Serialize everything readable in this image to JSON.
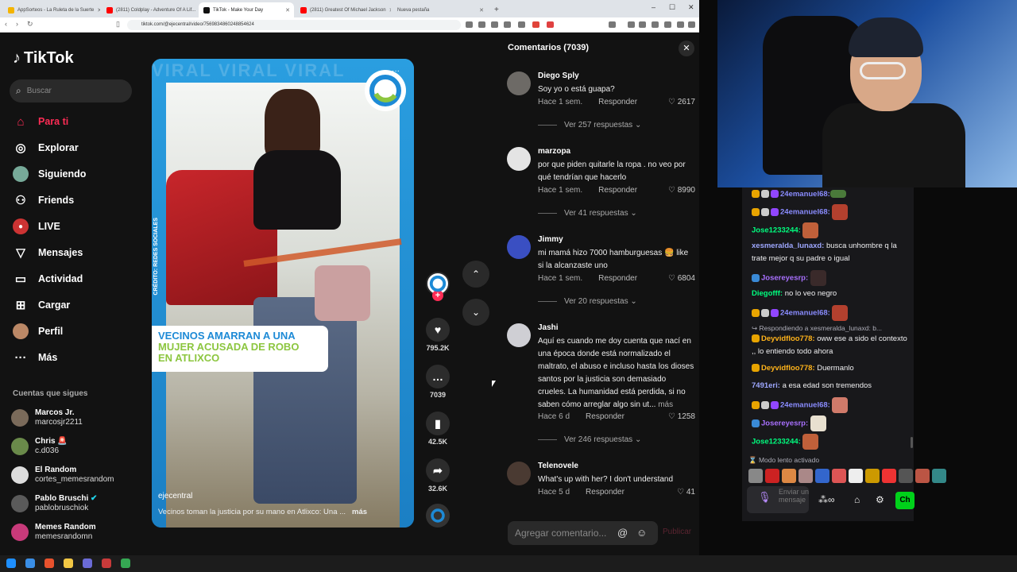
{
  "browser": {
    "tabs": [
      {
        "title": "AppSorteos - La Ruleta de la Suerte",
        "color": "#f4b400"
      },
      {
        "title": "(2811) Coldplay - Adventure Of A Lif...",
        "color": "#ff0000"
      },
      {
        "title": "TikTok - Make Your Day",
        "color": "#111111",
        "active": true
      },
      {
        "title": "(2811) Greatest Of Michael Jackson",
        "color": "#ff0000"
      },
      {
        "title": "Nueva pestaña",
        "color": "#cccccc"
      }
    ],
    "url": "tiktok.com/@ejecentral/video/7569834860248854624"
  },
  "sidebar": {
    "logo": "TikTok",
    "search_placeholder": "Buscar",
    "nav": [
      {
        "label": "Para ti",
        "icon": "home-icon",
        "active": true
      },
      {
        "label": "Explorar",
        "icon": "compass-icon"
      },
      {
        "label": "Siguiendo",
        "icon": "following-icon"
      },
      {
        "label": "Friends",
        "icon": "friends-icon"
      },
      {
        "label": "LIVE",
        "icon": "live-icon"
      },
      {
        "label": "Mensajes",
        "icon": "messages-icon"
      },
      {
        "label": "Actividad",
        "icon": "activity-icon"
      },
      {
        "label": "Cargar",
        "icon": "upload-icon"
      },
      {
        "label": "Perfil",
        "icon": "profile-icon"
      },
      {
        "label": "Más",
        "icon": "more-icon"
      }
    ],
    "following_header": "Cuentas que sigues",
    "following": [
      {
        "name": "Marcos Jr.",
        "handle": "marcosjr2211"
      },
      {
        "name": "Chris 🚨",
        "handle": "c.d036"
      },
      {
        "name": "El Random",
        "handle": "cortes_memesrandom"
      },
      {
        "name": "Pablo Bruschi",
        "handle": "pablobruschiok"
      },
      {
        "name": "Memes Random",
        "handle": "memesrandomn"
      }
    ]
  },
  "video": {
    "watermark": "VIRAL VIRAL VIRAL",
    "credit": "CRÉDITO: REDES SOCIALES",
    "headline_line1": "VECINOS AMARRAN A UNA",
    "headline_line2": "MUJER ACUSADA DE ROBO",
    "headline_line3": "EN ATLIXCO",
    "author": "ejecentral",
    "description": "Vecinos toman la justicia por su mano en Atlixco: Una ...",
    "more": "más"
  },
  "actions": {
    "likes": "795.2K",
    "comments": "7039",
    "saves": "42.5K",
    "shares": "32.6K"
  },
  "comments": {
    "title": "Comentarios (7039)",
    "input_placeholder": "Agregar comentario...",
    "publish": "Publicar",
    "reply_label": "Responder",
    "items": [
      {
        "user": "Diego Sply",
        "text": "Soy yo o está guapa?",
        "time": "Hace 1 sem.",
        "likes": "2617",
        "replies": "Ver 257 respuestas"
      },
      {
        "user": "marzopa",
        "text": "por que piden quitarle la ropa . no veo por qué tendrían que hacerlo",
        "time": "Hace 1 sem.",
        "likes": "8990",
        "replies": "Ver 41 respuestas"
      },
      {
        "user": "Jimmy",
        "text": "mi mamá hizo 7000 hamburguesas 🍔 like si la alcanzaste uno",
        "time": "Hace 1 sem.",
        "likes": "6804",
        "replies": "Ver 20 respuestas"
      },
      {
        "user": "Jashi",
        "text": "Aquí es cuando me doy cuenta que nací en una época donde está normalizado el maltrato, el abuso e incluso hasta los dioses santos por la justicia son demasiado crueles. La humanidad está perdida, si no saben cómo arreglar algo sin ut...",
        "more": "más",
        "time": "Hace 6 d",
        "likes": "1258",
        "replies": "Ver 246 respuestas"
      },
      {
        "user": "Telenovele",
        "text": "What's up with her? I don't understand",
        "time": "Hace 5 d",
        "likes": "41"
      }
    ]
  },
  "chat": {
    "messages": [
      {
        "user": "24emanuel68:",
        "text": "",
        "color": "#8a8cff"
      },
      {
        "user": "24emanuel68:",
        "text": "",
        "color": "#8a8cff"
      },
      {
        "user": "Jose1233244:",
        "text": "",
        "color": "#00ff7f"
      },
      {
        "user": "xesmeralda_lunaxd:",
        "text": "busca unhombre q la trate mejor q su padre o igual",
        "color": "#9ea7ff"
      },
      {
        "user": "Josereyesrp:",
        "text": "",
        "color": "#a970ff"
      },
      {
        "user": "Diegofff:",
        "text": "no lo veo negro",
        "color": "#00ff7f"
      },
      {
        "user": "24emanuel68:",
        "text": "",
        "color": "#8a8cff"
      },
      {
        "reply": "Respondiendo a xesmeralda_lunaxd: b..."
      },
      {
        "user": "Deyvidfloo778:",
        "text": "oww ese a sido el contexto ,, lo entiendo todo ahora",
        "color": "#ffb31a"
      },
      {
        "user": "Deyvidfloo778:",
        "text": "Duermanlo",
        "color": "#ffb31a"
      },
      {
        "user": "7491eri:",
        "text": "a esa edad son tremendos",
        "color": "#9ea7ff"
      },
      {
        "user": "24emanuel68:",
        "text": "",
        "color": "#8a8cff"
      },
      {
        "user": "Josereyesrp:",
        "text": "",
        "color": "#a970ff"
      },
      {
        "user": "Jose1233244:",
        "text": "",
        "color": "#00ff7f"
      }
    ],
    "slow_mode": "Modo lento activado",
    "input_placeholder": "Enviar un mensaje",
    "send": "Ch"
  }
}
